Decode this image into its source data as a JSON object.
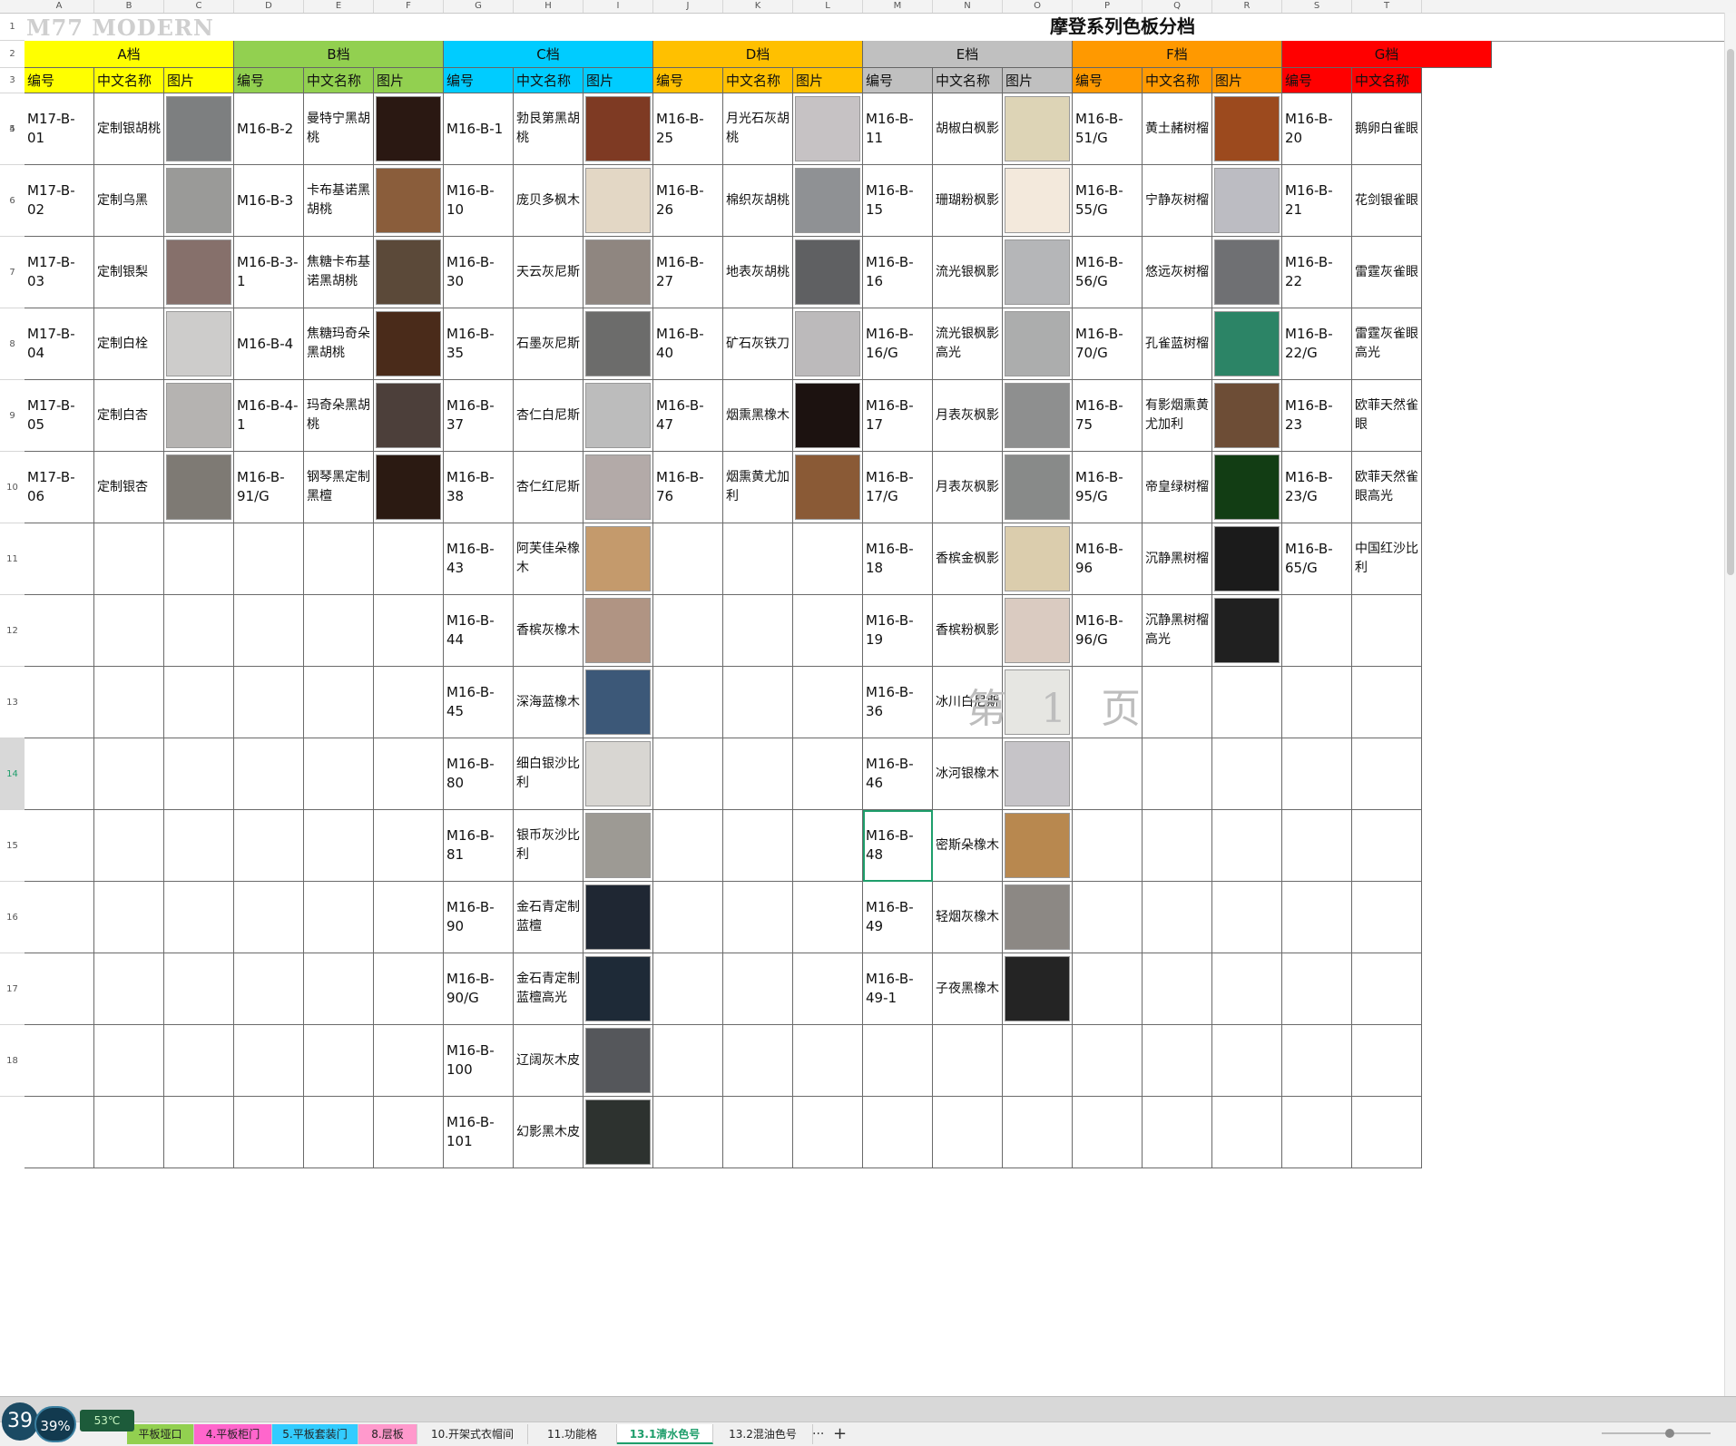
{
  "sheet_title": "摩登系列色板分档",
  "logo_text": "M77 MODERN",
  "watermark_text": "第 1 页",
  "col_letters": [
    "A",
    "B",
    "C",
    "D",
    "E",
    "F",
    "G",
    "H",
    "I",
    "J",
    "K",
    "L",
    "M",
    "N",
    "O",
    "P",
    "Q",
    "R",
    "S",
    "T"
  ],
  "row_numbers": [
    "1",
    "2",
    "3",
    "4",
    "5",
    "6",
    "7",
    "8",
    "9",
    "10",
    "11",
    "12",
    "13",
    "14",
    "15",
    "16",
    "17",
    "18"
  ],
  "selected_row": "14",
  "tiers": [
    {
      "label": "A档",
      "color": "#ffff00"
    },
    {
      "label": "B档",
      "color": "#92d050"
    },
    {
      "label": "C档",
      "color": "#00ccff"
    },
    {
      "label": "D档",
      "color": "#ffc000"
    },
    {
      "label": "E档",
      "color": "#c0c0c0"
    },
    {
      "label": "F档",
      "color": "#ff9900"
    },
    {
      "label": "G档",
      "color": "#ff0000"
    }
  ],
  "sub_headers": {
    "code": "编号",
    "name": "中文名称",
    "pic": "图片"
  },
  "groups": [
    {
      "items": [
        {
          "code": "M17-B-01",
          "name": "定制银胡桃",
          "swatch": "#7d7f80"
        },
        {
          "code": "M17-B-02",
          "name": "定制乌黑",
          "swatch": "#9a9a98"
        },
        {
          "code": "M17-B-03",
          "name": "定制银梨",
          "swatch": "#86706b"
        },
        {
          "code": "M17-B-04",
          "name": "定制白栓",
          "swatch": "#cdcccb"
        },
        {
          "code": "M17-B-05",
          "name": "定制白杏",
          "swatch": "#b5b3b1"
        },
        {
          "code": "M17-B-06",
          "name": "定制银杏",
          "swatch": "#7e7a74"
        }
      ]
    },
    {
      "items": [
        {
          "code": "M16-B-2",
          "name": "曼特宁黑胡桃",
          "swatch": "#2a1812"
        },
        {
          "code": "M16-B-3",
          "name": "卡布基诺黑胡桃",
          "swatch": "#8a5d3b"
        },
        {
          "code": "M16-B-3-1",
          "name": "焦糖卡布基诺黑胡桃",
          "swatch": "#5b4939"
        },
        {
          "code": "M16-B-4",
          "name": "焦糖玛奇朵黑胡桃",
          "swatch": "#4a2b1a"
        },
        {
          "code": "M16-B-4-1",
          "name": "玛奇朵黑胡桃",
          "swatch": "#4c3f3a"
        },
        {
          "code": "M16-B-91/G",
          "name": "钢琴黑定制黑檀",
          "swatch": "#2b1a12"
        }
      ]
    },
    {
      "items": [
        {
          "code": "M16-B-1",
          "name": "勃艮第黑胡桃",
          "swatch": "#7e3a23"
        },
        {
          "code": "M16-B-10",
          "name": "庞贝多枫木",
          "swatch": "#e3d7c5"
        },
        {
          "code": "M16-B-30",
          "name": "天云灰尼斯",
          "swatch": "#8f8680"
        },
        {
          "code": "M16-B-35",
          "name": "石墨灰尼斯",
          "swatch": "#6c6c6b"
        },
        {
          "code": "M16-B-37",
          "name": "杏仁白尼斯",
          "swatch": "#bcbcbc"
        },
        {
          "code": "M16-B-38",
          "name": "杏仁红尼斯",
          "swatch": "#b3aaa8"
        },
        {
          "code": "M16-B-43",
          "name": "阿芙佳朵橡木",
          "swatch": "#c49a6c"
        },
        {
          "code": "M16-B-44",
          "name": "香槟灰橡木",
          "swatch": "#b09483"
        },
        {
          "code": "M16-B-45",
          "name": "深海蓝橡木",
          "swatch": "#3c5878"
        },
        {
          "code": "M16-B-80",
          "name": "细白银沙比利",
          "swatch": "#d8d6d2"
        },
        {
          "code": "M16-B-81",
          "name": "银币灰沙比利",
          "swatch": "#9d9a94"
        },
        {
          "code": "M16-B-90",
          "name": "金石青定制蓝檀",
          "swatch": "#1f2733"
        },
        {
          "code": "M16-B-90/G",
          "name": "金石青定制蓝檀高光",
          "swatch": "#1e2a37"
        },
        {
          "code": "M16-B-100",
          "name": "辽阔灰木皮",
          "swatch": "#55575b"
        },
        {
          "code": "M16-B-101",
          "name": "幻影黑木皮",
          "swatch": "#2d322f"
        }
      ]
    },
    {
      "items": [
        {
          "code": "M16-B-25",
          "name": "月光石灰胡桃",
          "swatch": "#c6c2c4"
        },
        {
          "code": "M16-B-26",
          "name": "棉织灰胡桃",
          "swatch": "#8f9194"
        },
        {
          "code": "M16-B-27",
          "name": "地表灰胡桃",
          "swatch": "#5f6062"
        },
        {
          "code": "M16-B-40",
          "name": "矿石灰铁刀",
          "swatch": "#bcbabb"
        },
        {
          "code": "M16-B-47",
          "name": "烟熏黑橡木",
          "swatch": "#1c1210"
        },
        {
          "code": "M16-B-76",
          "name": "烟熏黄尤加利",
          "swatch": "#8a5a36"
        }
      ]
    },
    {
      "items": [
        {
          "code": "M16-B-11",
          "name": "胡椒白枫影",
          "swatch": "#ddd4b6"
        },
        {
          "code": "M16-B-15",
          "name": "珊瑚粉枫影",
          "swatch": "#f3e9dc"
        },
        {
          "code": "M16-B-16",
          "name": "流光银枫影",
          "swatch": "#b5b6b8"
        },
        {
          "code": "M16-B-16/G",
          "name": "流光银枫影高光",
          "swatch": "#acadad"
        },
        {
          "code": "M16-B-17",
          "name": "月表灰枫影",
          "swatch": "#8e8f8f"
        },
        {
          "code": "M16-B-17/G",
          "name": "月表灰枫影",
          "swatch": "#888a89"
        },
        {
          "code": "M16-B-18",
          "name": "香槟金枫影",
          "swatch": "#dbcdad"
        },
        {
          "code": "M16-B-19",
          "name": "香槟粉枫影",
          "swatch": "#dacbc1"
        },
        {
          "code": "M16-B-36",
          "name": "冰川白尼斯",
          "swatch": "#e6e6e2"
        },
        {
          "code": "M16-B-46",
          "name": "冰河银橡木",
          "swatch": "#c6c4c8"
        },
        {
          "code": "M16-B-48",
          "name": "密斯朵橡木",
          "swatch": "#b8884f"
        },
        {
          "code": "M16-B-49",
          "name": "轻烟灰橡木",
          "swatch": "#8c8884"
        },
        {
          "code": "M16-B-49-1",
          "name": "子夜黑橡木",
          "swatch": "#242424"
        }
      ]
    },
    {
      "items": [
        {
          "code": "M16-B-51/G",
          "name": "黄土赭树榴",
          "swatch": "#9c4a1e"
        },
        {
          "code": "M16-B-55/G",
          "name": "宁静灰树榴",
          "swatch": "#bcbcc2"
        },
        {
          "code": "M16-B-56/G",
          "name": "悠远灰树榴",
          "swatch": "#6f7073"
        },
        {
          "code": "M16-B-70/G",
          "name": "孔雀蓝树榴",
          "swatch": "#2c8466"
        },
        {
          "code": "M16-B-75",
          "name": "有影烟熏黄尤加利",
          "swatch": "#6d4d36"
        },
        {
          "code": "M16-B-95/G",
          "name": "帝皇绿树榴",
          "swatch": "#123d14"
        },
        {
          "code": "M16-B-96",
          "name": "沉静黑树榴",
          "swatch": "#1b1b1b"
        },
        {
          "code": "M16-B-96/G",
          "name": "沉静黑树榴高光",
          "swatch": "#202020"
        }
      ]
    },
    {
      "items": [
        {
          "code": "M16-B-20",
          "name": "鹅卵白雀眼"
        },
        {
          "code": "M16-B-21",
          "name": "花剑银雀眼"
        },
        {
          "code": "M16-B-22",
          "name": "雷霆灰雀眼"
        },
        {
          "code": "M16-B-22/G",
          "name": "雷霆灰雀眼高光"
        },
        {
          "code": "M16-B-23",
          "name": "欧菲天然雀眼"
        },
        {
          "code": "M16-B-23/G",
          "name": "欧菲天然雀眼高光"
        },
        {
          "code": "M16-B-65/G",
          "name": "中国红沙比利"
        }
      ]
    }
  ],
  "status": {
    "score": "39",
    "ring": "39%",
    "temp": "53℃"
  },
  "tabs": [
    {
      "label": "平板垭口",
      "color": "#92d050"
    },
    {
      "label": "4.平板柜门",
      "color": "#ff66cc"
    },
    {
      "label": "5.平板套装门",
      "color": "#33ccff"
    },
    {
      "label": "8.层板",
      "color": "#ff99cc"
    },
    {
      "label": "10.开架式衣帽间",
      "color": ""
    },
    {
      "label": "11.功能格",
      "color": ""
    },
    {
      "label": "13.1清水色号",
      "color": "",
      "active": true
    },
    {
      "label": "13.2混油色号",
      "color": ""
    }
  ],
  "tab_more": "···",
  "tab_add": "+"
}
